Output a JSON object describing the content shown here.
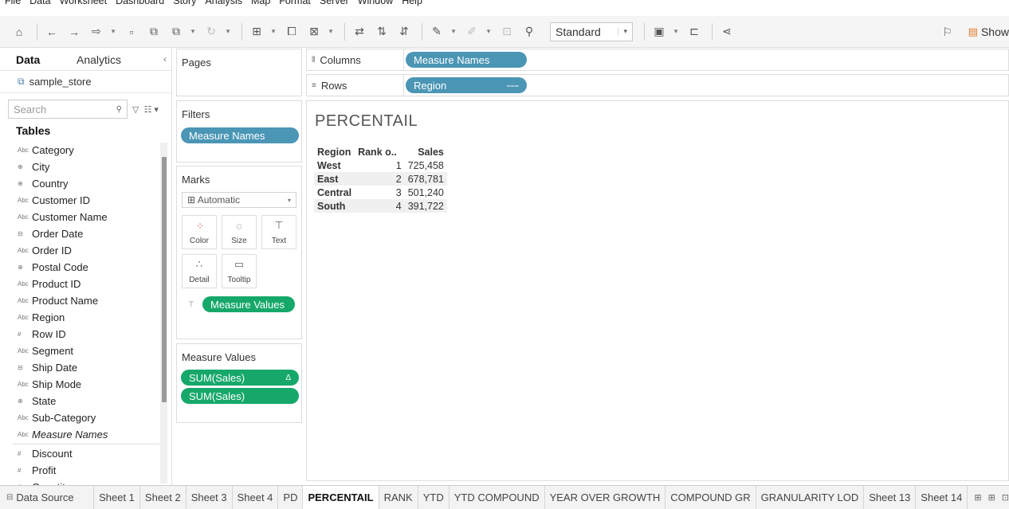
{
  "menu": [
    "File",
    "Data",
    "Worksheet",
    "Dashboard",
    "Story",
    "Analysis",
    "Map",
    "Format",
    "Server",
    "Window",
    "Help"
  ],
  "toolbar": {
    "fit_value": "Standard",
    "show_me_label": "Show"
  },
  "data_pane": {
    "tab_data": "Data",
    "tab_analytics": "Analytics",
    "datasource": "sample_store",
    "search_placeholder": "Search",
    "tables_title": "Tables",
    "dimensions": [
      {
        "type": "Abc",
        "name": "Category"
      },
      {
        "type": "geo",
        "name": "City"
      },
      {
        "type": "geo",
        "name": "Country"
      },
      {
        "type": "Abc",
        "name": "Customer ID"
      },
      {
        "type": "Abc",
        "name": "Customer Name"
      },
      {
        "type": "date",
        "name": "Order Date"
      },
      {
        "type": "Abc",
        "name": "Order ID"
      },
      {
        "type": "geo",
        "name": "Postal Code"
      },
      {
        "type": "Abc",
        "name": "Product ID"
      },
      {
        "type": "Abc",
        "name": "Product Name"
      },
      {
        "type": "Abc",
        "name": "Region"
      },
      {
        "type": "#",
        "name": "Row ID"
      },
      {
        "type": "Abc",
        "name": "Segment"
      },
      {
        "type": "date",
        "name": "Ship Date"
      },
      {
        "type": "Abc",
        "name": "Ship Mode"
      },
      {
        "type": "geo",
        "name": "State"
      },
      {
        "type": "Abc",
        "name": "Sub-Category"
      },
      {
        "type": "Abc",
        "name": "Measure Names"
      }
    ],
    "measures": [
      {
        "type": "#",
        "name": "Discount"
      },
      {
        "type": "#",
        "name": "Profit"
      },
      {
        "type": "#",
        "name": "Quantity"
      }
    ]
  },
  "cards": {
    "pages_title": "Pages",
    "filters_title": "Filters",
    "filters_pill": "Measure Names",
    "marks_title": "Marks",
    "marks_type": "Automatic",
    "mark_buttons": [
      "Color",
      "Size",
      "Text",
      "Detail",
      "Tooltip"
    ],
    "marks_pill": "Measure Values",
    "measure_values_title": "Measure Values",
    "measure_values_pills": [
      "SUM(Sales)",
      "SUM(Sales)"
    ]
  },
  "shelves": {
    "columns_label": "Columns",
    "columns_pill": "Measure Names",
    "rows_label": "Rows",
    "rows_pill": "Region"
  },
  "view": {
    "title": "PERCENTAIL",
    "headers": [
      "Region",
      "Rank o..",
      "Sales"
    ],
    "rows": [
      {
        "region": "West",
        "rank": "1",
        "sales": "725,458"
      },
      {
        "region": "East",
        "rank": "2",
        "sales": "678,781"
      },
      {
        "region": "Central",
        "rank": "3",
        "sales": "501,240"
      },
      {
        "region": "South",
        "rank": "4",
        "sales": "391,722"
      }
    ]
  },
  "tabs": {
    "datasource": "Data Source",
    "sheets": [
      "Sheet 1",
      "Sheet 2",
      "Sheet 3",
      "Sheet 4",
      "PD",
      "PERCENTAIL",
      "RANK",
      "YTD",
      "YTD COMPOUND",
      "YEAR OVER GROWTH",
      "COMPOUND GR",
      "GRANULARITY LOD",
      "Sheet 13",
      "Sheet 14"
    ],
    "active": "PERCENTAIL"
  },
  "colors": {
    "pill_blue": "#4b96b5",
    "pill_green": "#16a86a"
  }
}
